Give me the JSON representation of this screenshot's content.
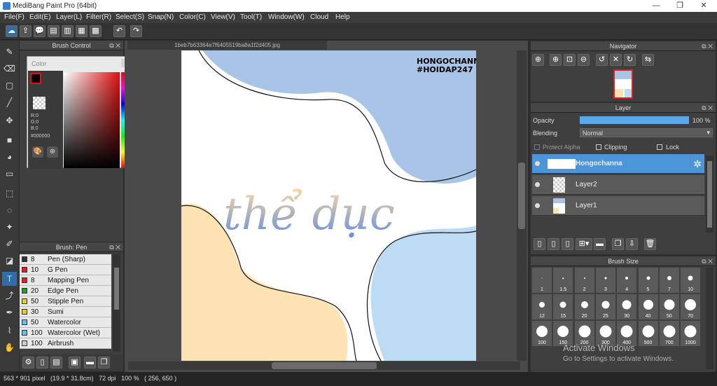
{
  "titlebar": {
    "title": "MediBang Paint Pro (64bit)",
    "minimize": "—",
    "maximize": "❐",
    "close": "✕"
  },
  "menu": [
    "File(F)",
    "Edit(E)",
    "Layer(L)",
    "Filter(R)",
    "Select(S)",
    "Snap(N)",
    "Color(C)",
    "View(V)",
    "Tool(T)",
    "Window(W)",
    "Cloud",
    "Help"
  ],
  "brush_control": {
    "title": "Brush Control"
  },
  "color_window": {
    "title": "Color",
    "r": "R:0",
    "g": "G:0",
    "b": "B:0",
    "hex": "#000000"
  },
  "brush_panel": {
    "title": "Brush: Pen",
    "items": [
      {
        "size": "8",
        "name": "Pen (Sharp)",
        "color": "#333333"
      },
      {
        "size": "10",
        "name": "G Pen",
        "color": "#e02020"
      },
      {
        "size": "8",
        "name": "Mapping Pen",
        "color": "#e02020"
      },
      {
        "size": "20",
        "name": "Edge Pen",
        "color": "#20a020"
      },
      {
        "size": "50",
        "name": "Stipple Pen",
        "color": "#e0d020"
      },
      {
        "size": "30",
        "name": "Sumi",
        "color": "#e0d020"
      },
      {
        "size": "50",
        "name": "Watercolor",
        "color": "#60c0f0"
      },
      {
        "size": "100",
        "name": "Watercolor (Wet)",
        "color": "#60c0f0"
      },
      {
        "size": "100",
        "name": "Airbrush",
        "color": "#cccccc"
      }
    ]
  },
  "document": {
    "tab": "1beb7b63364e7f6405519ba8a1f2d405.jpg",
    "watermark1": "HONGOCHANNA",
    "watermark2": "#HOIDAP247",
    "artwork_text": "thể dục"
  },
  "navigator": {
    "title": "Navigator"
  },
  "layer_panel": {
    "title": "Layer",
    "opacity_label": "Opacity",
    "opacity_value": "100 %",
    "opacity_percent": 100,
    "blending_label": "Blending",
    "blending_value": "Normal",
    "protect_alpha": "Protect Alpha",
    "clipping": "Clipping",
    "lock": "Lock",
    "layers": [
      "Hongochanna",
      "Layer2",
      "Layer1"
    ]
  },
  "brush_size": {
    "title": "Brush Size",
    "sizes": [
      "1",
      "1.5",
      "2",
      "3",
      "4",
      "5",
      "7",
      "10",
      "12",
      "15",
      "20",
      "25",
      "30",
      "40",
      "50",
      "70",
      "100",
      "150",
      "200",
      "300",
      "400",
      "500",
      "700",
      "1000"
    ]
  },
  "activate": {
    "line1": "Activate Windows",
    "line2": "Go to Settings to activate Windows."
  },
  "status": {
    "text": "563 * 901 pixel   (19.9 * 31.8cm)   72 dpi   100 %   ( 256, 650 )"
  }
}
